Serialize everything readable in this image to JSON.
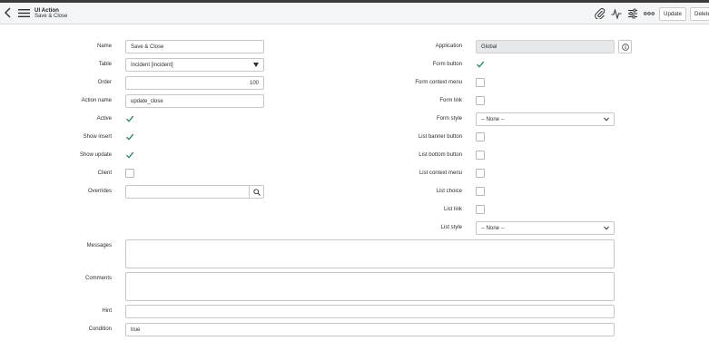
{
  "header": {
    "record_type": "UI Action",
    "record_name": "Save & Close",
    "update_label": "Update",
    "delete_label": "Delete"
  },
  "left": {
    "name_label": "Name",
    "name_value": "Save & Close",
    "table_label": "Table",
    "table_value": "Incident [incident]",
    "order_label": "Order",
    "order_value": "100",
    "action_name_label": "Action name",
    "action_name_value": "update_close",
    "active_label": "Active",
    "active_checked": true,
    "show_insert_label": "Show insert",
    "show_insert_checked": true,
    "show_update_label": "Show update",
    "show_update_checked": true,
    "client_label": "Client",
    "client_checked": false,
    "overrides_label": "Overrides",
    "overrides_value": ""
  },
  "right": {
    "application_label": "Application",
    "application_value": "Global",
    "form_button_label": "Form button",
    "form_button_checked": true,
    "form_context_menu_label": "Form context menu",
    "form_link_label": "Form link",
    "form_style_label": "Form style",
    "form_style_value": "-- None --",
    "list_banner_button_label": "List banner button",
    "list_bottom_button_label": "List bottom button",
    "list_context_menu_label": "List context menu",
    "list_choice_label": "List choice",
    "list_link_label": "List link",
    "list_style_label": "List style",
    "list_style_value": "-- None --"
  },
  "bottom": {
    "messages_label": "Messages",
    "comments_label": "Comments",
    "hint_label": "Hint",
    "condition_label": "Condition",
    "condition_value": "true"
  },
  "colors": {
    "check": "#2a7d6e",
    "header_bg": "#f4f5f6",
    "readonly_bg": "#e7e8ea"
  }
}
